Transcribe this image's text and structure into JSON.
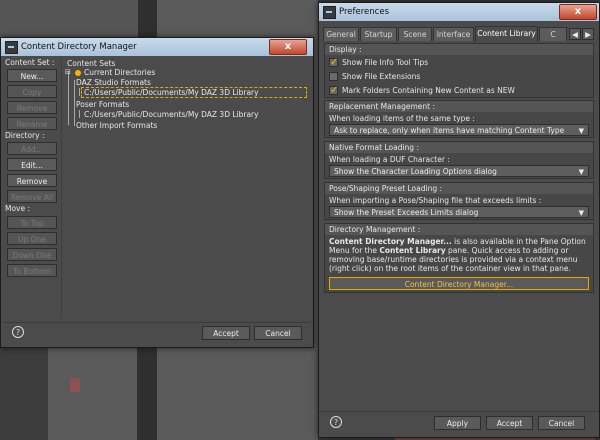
{
  "cdm": {
    "title": "Content Directory Manager",
    "close": "x",
    "content_set_label": "Content Set :",
    "directory_label": "Directory :",
    "move_label": "Move :",
    "buttons": {
      "new": "New...",
      "copy": "Copy",
      "remove_set": "Remove",
      "rename": "Rename",
      "add": "Add...",
      "edit": "Edit...",
      "remove_dir": "Remove",
      "remove_all": "Remove All",
      "to_top": "To Top",
      "up_one": "Up One",
      "down_one": "Down One",
      "to_bottom": "To Bottom"
    },
    "tree": {
      "header": "Content Sets",
      "current": "Current Directories",
      "daz_formats": "DAZ Studio Formats",
      "daz_path": "C:/Users/Public/Documents/My DAZ 3D Library",
      "poser_formats": "Poser Formats",
      "poser_path": "C:/Users/Public/Documents/My DAZ 3D Library",
      "other": "Other Import Formats"
    },
    "help": "?",
    "accept": "Accept",
    "cancel": "Cancel"
  },
  "prefs": {
    "title": "Preferences",
    "close": "x",
    "tabs": [
      "General",
      "Startup",
      "Scene",
      "Interface",
      "Content Library",
      "C"
    ],
    "active_tab": "Content Library",
    "display": {
      "title": "Display :",
      "show_file_info": "Show File Info Tool Tips",
      "show_file_info_checked": true,
      "show_ext": "Show File Extensions",
      "show_ext_checked": false,
      "mark_new": "Mark Folders Containing New Content as NEW",
      "mark_new_checked": true
    },
    "replacement": {
      "title": "Replacement Management :",
      "label": "When loading items of the same type :",
      "value": "Ask to replace, only when items have matching Content Type"
    },
    "native": {
      "title": "Native Format Loading :",
      "label": "When loading a DUF Character :",
      "value": "Show the Character Loading Options dialog"
    },
    "pose": {
      "title": "Pose/Shaping Preset Loading :",
      "label": "When importing a Pose/Shaping file that exceeds limits :",
      "value": "Show the Preset Exceeds Limits dialog"
    },
    "directory": {
      "title": "Directory Management :",
      "text_bold1": "Content Directory Manager...",
      "text1": " is also available in the Pane Option Menu for the ",
      "text_bold2": "Content Library",
      "text2": " pane. Quick access to adding or removing base/runtime directories is provided via a context menu (right click) on the root items of the container view in that pane.",
      "button": "Content Directory Manager..."
    },
    "help": "?",
    "apply": "Apply",
    "accept": "Accept",
    "cancel": "Cancel"
  },
  "colors": {
    "accent": "#e8a800",
    "titlebar": "#b8cfe4",
    "panel": "#4b4b4b"
  }
}
